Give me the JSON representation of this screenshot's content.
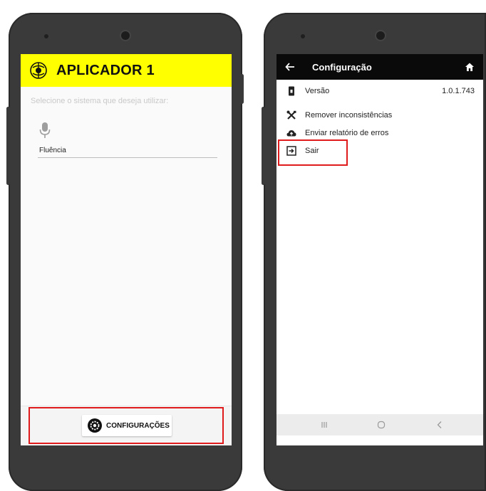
{
  "left_screen": {
    "app_title": "APLICADOR 1",
    "prompt": "Selecione o sistema que deseja utilizar:",
    "system_option": {
      "icon": "microphone-icon",
      "label": "Fluência"
    },
    "footer_button": {
      "icon": "gear-icon",
      "label": "CONFIGURAÇÕES"
    }
  },
  "right_screen": {
    "header": {
      "title": "Configuração",
      "back_icon": "back-arrow-icon",
      "home_icon": "home-icon"
    },
    "items": [
      {
        "icon": "phone-info-icon",
        "label": "Versão",
        "value": "1.0.1.743"
      },
      {
        "icon": "tools-icon",
        "label": "Remover inconsistências"
      },
      {
        "icon": "cloud-upload-icon",
        "label": "Enviar relatório de erros"
      },
      {
        "icon": "exit-icon",
        "label": "Sair"
      }
    ],
    "navbar": [
      "recent-apps-icon",
      "home-circle-icon",
      "back-chevron-icon"
    ]
  },
  "colors": {
    "header_yellow": "#ffff00",
    "highlight_red": "#e01b1b",
    "right_header": "#0a0a0a"
  }
}
